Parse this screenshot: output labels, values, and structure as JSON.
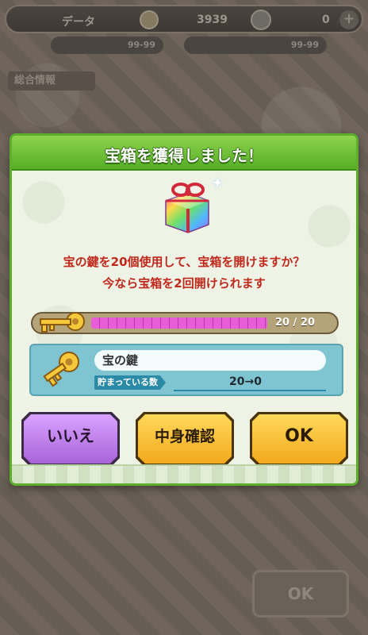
{
  "background": {
    "player_name": "データ",
    "money": "3939",
    "gem_count": "0",
    "stat_a": "99-99",
    "stat_b": "99-99",
    "section_tab": "総合情報",
    "ok_label": "OK"
  },
  "dialog": {
    "title": "宝箱を獲得しました！",
    "message_line1": "宝の鍵を20個使用して、宝箱を開けますか？",
    "message_line2": "今なら宝箱を2回開けられます",
    "key_bar": {
      "count_text": "20 / 20",
      "progress": 1.0
    },
    "item": {
      "name": "宝の鍵",
      "held_label": "貯まっている数",
      "held_value": "20→0"
    },
    "buttons": {
      "no": "いいえ",
      "check_contents": "中身確認",
      "ok": "OK"
    }
  },
  "colors": {
    "header_green": "#56ad26",
    "message_red": "#c0281c",
    "progress_pink": "#e85ed8",
    "button_purple": "#a864d8",
    "button_yellow": "#f2a91d"
  },
  "icons": {
    "treasure": "rainbow-gift-box-icon",
    "key": "gold-key-icon"
  }
}
